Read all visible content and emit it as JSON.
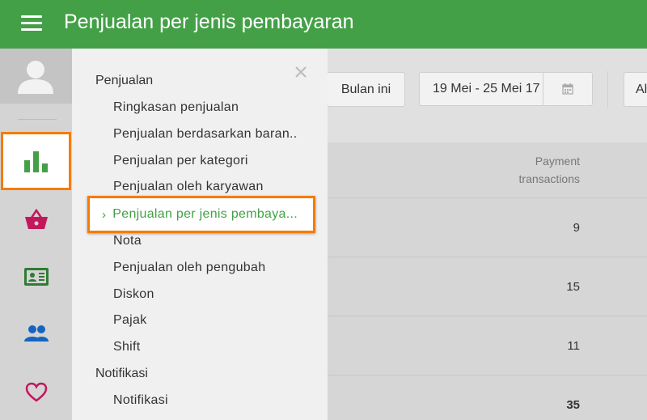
{
  "appbar": {
    "title": "Penjualan per jenis pembayaran"
  },
  "rail": {
    "items": [
      {
        "icon": "reports-bar-chart-icon",
        "color": "#43a047",
        "active": true
      },
      {
        "icon": "basket-icon",
        "color": "#c2185b"
      },
      {
        "icon": "id-card-icon",
        "color": "#2e7d32"
      },
      {
        "icon": "people-icon",
        "color": "#1565c0"
      },
      {
        "icon": "heart-icon",
        "color": "#c2185b"
      }
    ]
  },
  "toolbar": {
    "period_button": "Bulan ini",
    "date_range": "19 Mei - 25 Mei 17",
    "all_button": "Al"
  },
  "table": {
    "column_header_line1": "Payment",
    "column_header_line2": "transactions",
    "rows": [
      "9",
      "15",
      "11"
    ],
    "total": "35"
  },
  "drawer": {
    "sections": [
      {
        "title": "Penjualan",
        "items": [
          "Ringkasan penjualan",
          "Penjualan berdasarkan baran..",
          "Penjualan per kategori",
          "Penjualan oleh karyawan",
          "Penjualan per jenis pembaya...",
          "Nota",
          "Penjualan oleh pengubah",
          "Diskon",
          "Pajak",
          "Shift"
        ],
        "active_index": 4
      },
      {
        "title": "Notifikasi",
        "items": [
          "Notifikasi"
        ]
      }
    ]
  },
  "colors": {
    "appbar": "#43a047",
    "highlight_border": "#f57c00",
    "active_text": "#43a047"
  }
}
